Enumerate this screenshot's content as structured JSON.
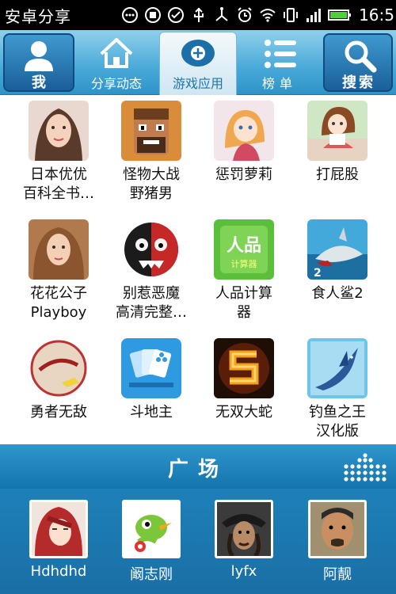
{
  "status_bar": {
    "title": "安卓分享",
    "time": "16:5",
    "icons": [
      "more-icon",
      "sd-icon",
      "check-circle-icon",
      "usb-icon",
      "usb-alt-icon",
      "alarm-icon",
      "wifi-icon",
      "vibrate-icon",
      "signal-icon",
      "battery-icon"
    ]
  },
  "tabs": [
    {
      "label": "我",
      "icon": "person-icon"
    },
    {
      "label": "分享动态",
      "icon": "home-icon"
    },
    {
      "label": "游戏应用",
      "icon": "gamepad-icon",
      "active": true
    },
    {
      "label": "榜单",
      "icon": "list-icon"
    },
    {
      "label": "搜索",
      "icon": "search-icon"
    }
  ],
  "apps": [
    {
      "name": "日本优优\n百科全书…",
      "icon": "portrait-girl-icon",
      "color": "#f0c7b0"
    },
    {
      "name": "怪物大战\n野猪男",
      "icon": "monster-face-icon",
      "color": "#c9863f"
    },
    {
      "name": "惩罚萝莉",
      "icon": "anime-girl-icon",
      "color": "#f6c98e"
    },
    {
      "name": "打屁股",
      "icon": "anime-schoolgirl-icon",
      "color": "#d6e9c5"
    },
    {
      "name": "花花公子\nPlayboy",
      "icon": "portrait-woman-icon",
      "color": "#c58a55"
    },
    {
      "name": "别惹恶魔\n高清完整…",
      "icon": "demon-face-icon",
      "color": "#cc2b2b"
    },
    {
      "name": "人品计算\n器",
      "icon": "rp-calculator-icon",
      "color": "#5bbf3a"
    },
    {
      "name": "食人鲨2",
      "icon": "shark-icon",
      "color": "#3fa6d8"
    },
    {
      "name": "勇者无敌",
      "icon": "brave-logo-icon",
      "color": "#e7d7c3"
    },
    {
      "name": "斗地主",
      "icon": "cards-icon",
      "color": "#2f9be0"
    },
    {
      "name": "无双大蛇",
      "icon": "snake-icon",
      "color": "#2a1408"
    },
    {
      "name": "钓鱼之王\n汉化版",
      "icon": "marlin-icon",
      "color": "#6ec3ea"
    }
  ],
  "plaza": {
    "title": "广场",
    "menu_icon": "dots-grid-icon"
  },
  "friends": [
    {
      "name": "Hdhdhd",
      "icon": "anime-redhair-avatar"
    },
    {
      "name": "阚志刚",
      "icon": "green-bird-avatar"
    },
    {
      "name": "lyfx",
      "icon": "pirate-avatar"
    },
    {
      "name": "阿靓",
      "icon": "man-face-avatar"
    }
  ]
}
